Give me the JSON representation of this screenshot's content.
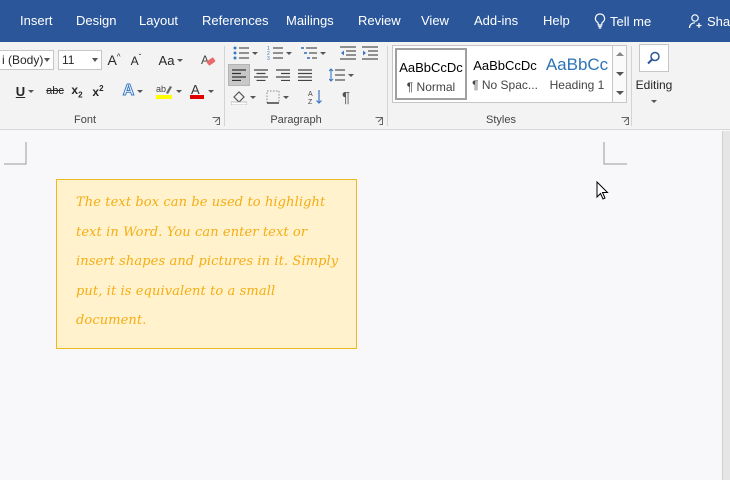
{
  "tabs": [
    "Insert",
    "Design",
    "Layout",
    "References",
    "Mailings",
    "Review",
    "View",
    "Add-ins",
    "Help"
  ],
  "tell_me": "Tell me",
  "share": "Shar",
  "font": {
    "name": "i (Body)",
    "size": "11",
    "group_label": "Font"
  },
  "paragraph": {
    "group_label": "Paragraph"
  },
  "styles": {
    "group_label": "Styles",
    "items": [
      {
        "preview": "AaBbCcDc",
        "name": "¶ Normal"
      },
      {
        "preview": "AaBbCcDc",
        "name": "¶ No Spac..."
      },
      {
        "preview": "AaBbCc",
        "name": "Heading 1"
      }
    ]
  },
  "editing": {
    "label": "Editing"
  },
  "textbox": {
    "text": "The text box can be used to highlight text in Word. You can enter text or insert shapes and pictures in it. Simply put, it is equivalent to a small document."
  },
  "colors": {
    "tab_bar": "#2b579a",
    "textbox_fill": "#fff2cc",
    "textbox_border": "#f0b820",
    "textbox_text": "#f5ad13",
    "heading1_blue": "#2e74b5"
  }
}
